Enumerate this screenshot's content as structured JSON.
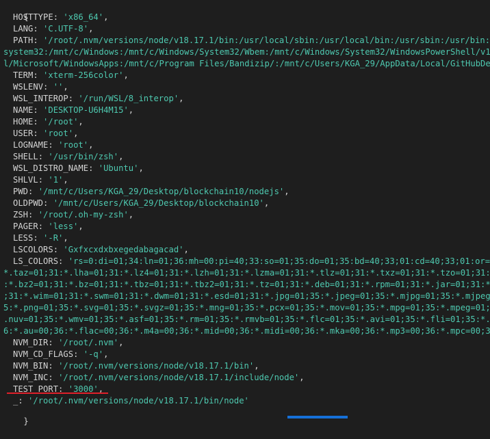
{
  "open_brace": "{",
  "close_brace": "}",
  "entries": [
    {
      "key": "HOSTTYPE",
      "value": "'x86_64'",
      "sep": ","
    },
    {
      "key": "LANG",
      "value": "'C.UTF-8'",
      "sep": ","
    },
    {
      "key": "PATH",
      "value": "'/root/.nvm/versions/node/v18.17.1/bin:/usr/local/sbin:/usr/local/bin:/usr/sbin:/usr/bin:/sb",
      "sep": ""
    },
    {
      "key": "",
      "value": "system32:/mnt/c/Windows:/mnt/c/Windows/System32/Wbem:/mnt/c/Windows/System32/WindowsPowerShell/v1.0/",
      "sep": "",
      "cont": true
    },
    {
      "key": "",
      "value": "l/Microsoft/WindowsApps:/mnt/c/Program Files/Bandizip/:/mnt/c/Users/KGA_29/AppData/Local/GitHubDeskt",
      "sep": "",
      "cont": true
    },
    {
      "key": "TERM",
      "value": "'xterm-256color'",
      "sep": ","
    },
    {
      "key": "WSLENV",
      "value": "''",
      "sep": ","
    },
    {
      "key": "WSL_INTEROP",
      "value": "'/run/WSL/8_interop'",
      "sep": ","
    },
    {
      "key": "NAME",
      "value": "'DESKTOP-U6H4M15'",
      "sep": ","
    },
    {
      "key": "HOME",
      "value": "'/root'",
      "sep": ","
    },
    {
      "key": "USER",
      "value": "'root'",
      "sep": ","
    },
    {
      "key": "LOGNAME",
      "value": "'root'",
      "sep": ","
    },
    {
      "key": "SHELL",
      "value": "'/usr/bin/zsh'",
      "sep": ","
    },
    {
      "key": "WSL_DISTRO_NAME",
      "value": "'Ubuntu'",
      "sep": ","
    },
    {
      "key": "SHLVL",
      "value": "'1'",
      "sep": ","
    },
    {
      "key": "PWD",
      "value": "'/mnt/c/Users/KGA_29/Desktop/blockchain10/nodejs'",
      "sep": ","
    },
    {
      "key": "OLDPWD",
      "value": "'/mnt/c/Users/KGA_29/Desktop/blockchain10'",
      "sep": ","
    },
    {
      "key": "ZSH",
      "value": "'/root/.oh-my-zsh'",
      "sep": ","
    },
    {
      "key": "PAGER",
      "value": "'less'",
      "sep": ","
    },
    {
      "key": "LESS",
      "value": "'-R'",
      "sep": ","
    },
    {
      "key": "LSCOLORS",
      "value": "'Gxfxcxdxbxegedabagacad'",
      "sep": ","
    },
    {
      "key": "LS_COLORS",
      "value": "'rs=0:di=01;34:ln=01;36:mh=00:pi=40;33:so=01;35:do=01;35:bd=40;33;01:cd=40;33;01:or=40;",
      "sep": ""
    },
    {
      "key": "",
      "value": "*.taz=01;31:*.lha=01;31:*.lz4=01;31:*.lzh=01;31:*.lzma=01;31:*.tlz=01;31:*.txz=01;31:*.tzo=01;31:*.t",
      "sep": "",
      "cont": true
    },
    {
      "key": "",
      "value": ":*.bz2=01;31:*.bz=01;31:*.tbz=01;31:*.tbz2=01;31:*.tz=01;31:*.deb=01;31:*.rpm=01;31:*.jar=01;31:*.wa",
      "sep": "",
      "cont": true
    },
    {
      "key": "",
      "value": ";31:*.wim=01;31:*.swm=01;31:*.dwm=01;31:*.esd=01;31:*.jpg=01;35:*.jpeg=01;35:*.mjpg=01;35:*.mjpeg=01",
      "sep": "",
      "cont": true
    },
    {
      "key": "",
      "value": "5:*.png=01;35:*.svg=01;35:*.svgz=01;35:*.mng=01;35:*.pcx=01;35:*.mov=01;35:*.mpg=01;35:*.mpeg=01;35:",
      "sep": "",
      "cont": true
    },
    {
      "key": "",
      "value": ".nuv=01;35:*.wmv=01;35:*.asf=01;35:*.rm=01;35:*.rmvb=01;35:*.flc=01;35:*.avi=01;35:*.fli=01;35:*.flv",
      "sep": "",
      "cont": true
    },
    {
      "key": "",
      "value": "6:*.au=00;36:*.flac=00;36:*.m4a=00;36:*.mid=00;36:*.midi=00;36:*.mka=00;36:*.mp3=00;36:*.mpc=00;36:*",
      "sep": "",
      "cont": true
    },
    {
      "key": "NVM_DIR",
      "value": "'/root/.nvm'",
      "sep": ","
    },
    {
      "key": "NVM_CD_FLAGS",
      "value": "'-q'",
      "sep": ","
    },
    {
      "key": "NVM_BIN",
      "value": "'/root/.nvm/versions/node/v18.17.1/bin'",
      "sep": ","
    },
    {
      "key": "NVM_INC",
      "value": "'/root/.nvm/versions/node/v18.17.1/include/node'",
      "sep": ","
    },
    {
      "key": "TEST_PORT",
      "value": "'3000'",
      "sep": ","
    },
    {
      "key": "_",
      "value": "'/root/.nvm/versions/node/v18.17.1/bin/node'",
      "sep": ""
    }
  ],
  "colors": {
    "background": "#1e1e1e",
    "text": "#d4d4d4",
    "string": "#4ec9b0",
    "highlight_underline": "#e0202a",
    "scroll_thumb": "#1570d8"
  }
}
